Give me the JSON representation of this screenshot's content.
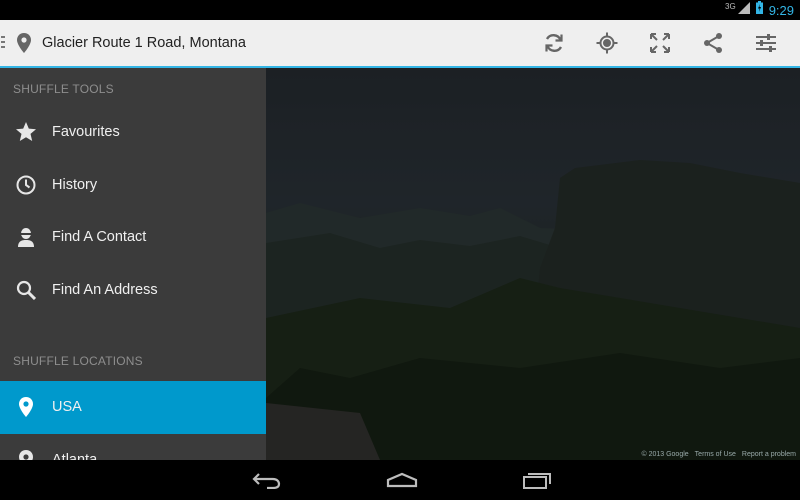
{
  "status_bar": {
    "network": "3G",
    "time": "9:29"
  },
  "action_bar": {
    "title": "Glacier Route 1 Road, Montana",
    "actions": [
      "refresh-icon",
      "my-location-icon",
      "fullscreen-icon",
      "share-icon",
      "settings-sliders-icon"
    ]
  },
  "drawer": {
    "tools_header": "SHUFFLE TOOLS",
    "tools": [
      {
        "label": "Favourites",
        "icon": "star-icon"
      },
      {
        "label": "History",
        "icon": "clock-icon"
      },
      {
        "label": "Find A Contact",
        "icon": "contact-icon"
      },
      {
        "label": "Find An Address",
        "icon": "search-icon"
      }
    ],
    "locations_header": "SHUFFLE LOCATIONS",
    "locations": [
      {
        "label": "USA",
        "icon": "pin-icon",
        "selected": true
      },
      {
        "label": "Atlanta",
        "icon": "pin-icon",
        "selected": false
      }
    ]
  },
  "map": {
    "attribution": [
      "© 2013 Google",
      "Terms of Use",
      "Report a problem"
    ]
  },
  "colors": {
    "accent": "#33b5e5",
    "selected": "#0099cc",
    "drawer": "#3b3b3b"
  }
}
